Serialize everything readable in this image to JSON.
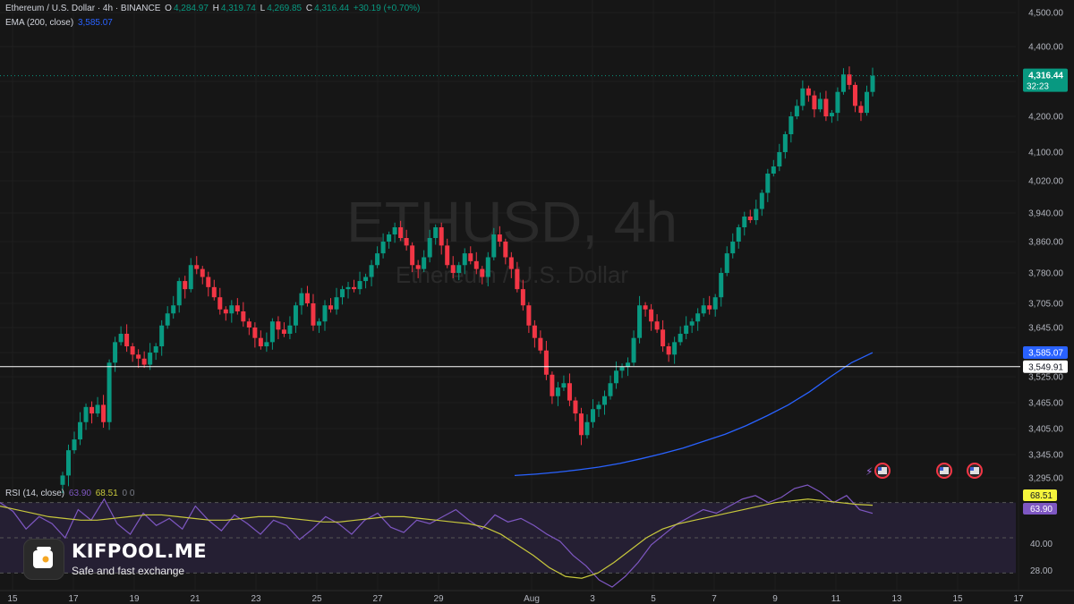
{
  "header": {
    "symbol_title": "Ethereum / U.S. Dollar · 4h · BINANCE",
    "open_label": "O",
    "open": "4,284.97",
    "high_label": "H",
    "high": "4,319.74",
    "low_label": "L",
    "low": "4,269.85",
    "close_label": "C",
    "close": "4,316.44",
    "change": "+30.19 (+0.70%)",
    "ema_label": "EMA (200, close)",
    "ema_value": "3,585.07",
    "rsi_label": "RSI (14, close)",
    "rsi_value": "63.90",
    "rsi_ma_value": "68.51",
    "rsi_extra": "0  0"
  },
  "watermark": {
    "symbol": "ETHUSD, 4h",
    "name": "Ethereum / U.S. Dollar"
  },
  "price_axis": {
    "ticks": [
      "4,500.00",
      "4,400.00",
      "4,300.00",
      "4,200.00",
      "4,100.00",
      "4,020.00",
      "3,940.00",
      "3,860.00",
      "3,780.00",
      "3,705.00",
      "3,645.00",
      "3,585.07",
      "3,549.91",
      "3,525.00",
      "3,465.00",
      "3,405.00",
      "3,345.00",
      "3,295.00"
    ],
    "last_price": "4,316.44",
    "countdown": "32:23",
    "ema_tag": "3,585.07",
    "crosshair_tag": "3,549.91"
  },
  "rsi_axis": {
    "ma_tag": "68.51",
    "rsi_tag": "63.90",
    "ticks": [
      "40.00",
      "28.00"
    ]
  },
  "time_axis": [
    "15",
    "17",
    "19",
    "21",
    "23",
    "25",
    "27",
    "29",
    "Aug",
    "3",
    "5",
    "7",
    "9",
    "11",
    "13",
    "15",
    "17"
  ],
  "logo": {
    "title": "KIFPOOL.ME",
    "subtitle": "Safe and fast exchange"
  },
  "colors": {
    "up": "#089981",
    "down": "#f23645",
    "ema": "#2962ff",
    "rsi": "#7e57c2",
    "rsi_ma": "#c8c83c",
    "bg": "#161616"
  },
  "chart_data": {
    "type": "candlestick",
    "interval": "4h",
    "price_range": [
      3265,
      4530
    ],
    "series": [
      {
        "name": "Ethereum / U.S. Dollar",
        "closes": [
          3300,
          3355,
          3380,
          3420,
          3455,
          3440,
          3460,
          3420,
          3560,
          3610,
          3630,
          3600,
          3580,
          3570,
          3555,
          3585,
          3600,
          3650,
          3680,
          3700,
          3760,
          3740,
          3800,
          3790,
          3770,
          3745,
          3720,
          3690,
          3680,
          3700,
          3685,
          3660,
          3645,
          3620,
          3600,
          3610,
          3660,
          3640,
          3630,
          3650,
          3700,
          3730,
          3705,
          3650,
          3660,
          3700,
          3690,
          3720,
          3740,
          3745,
          3740,
          3760,
          3770,
          3800,
          3830,
          3860,
          3880,
          3900,
          3870,
          3850,
          3800,
          3790,
          3820,
          3870,
          3900,
          3850,
          3800,
          3780,
          3800,
          3830,
          3810,
          3790,
          3770,
          3820,
          3880,
          3860,
          3820,
          3790,
          3740,
          3700,
          3650,
          3620,
          3590,
          3530,
          3480,
          3500,
          3510,
          3470,
          3440,
          3390,
          3420,
          3450,
          3460,
          3480,
          3510,
          3540,
          3550,
          3560,
          3620,
          3700,
          3690,
          3660,
          3640,
          3600,
          3580,
          3610,
          3630,
          3650,
          3660,
          3680,
          3700,
          3690,
          3720,
          3780,
          3830,
          3860,
          3900,
          3930,
          3920,
          3950,
          3990,
          4040,
          4060,
          4100,
          4150,
          4200,
          4230,
          4280,
          4260,
          4220,
          4250,
          4200,
          4210,
          4270,
          4320,
          4290,
          4230,
          4210,
          4270,
          4316.44
        ]
      },
      {
        "name": "EMA (200, close)",
        "values": [
          3300,
          3303,
          3307,
          3312,
          3318,
          3326,
          3336,
          3347,
          3360,
          3376,
          3392,
          3412,
          3435,
          3460,
          3490,
          3525,
          3560,
          3585
        ]
      },
      {
        "name": "RSI (14, close)",
        "range": [
          20,
          80
        ],
        "values": [
          70,
          65,
          55,
          62,
          58,
          50,
          66,
          60,
          72,
          58,
          52,
          64,
          57,
          61,
          55,
          68,
          60,
          54,
          63,
          58,
          52,
          60,
          57,
          49,
          55,
          62,
          58,
          52,
          60,
          64,
          56,
          53,
          60,
          58,
          62,
          66,
          60,
          55,
          63,
          59,
          61,
          57,
          52,
          48,
          40,
          34,
          26,
          22,
          28,
          36,
          46,
          52,
          58,
          62,
          66,
          64,
          68,
          72,
          74,
          70,
          73,
          78,
          80,
          76,
          70,
          74,
          66,
          63.9
        ]
      },
      {
        "name": "RSI-based MA",
        "values": [
          68,
          66,
          64,
          62,
          61,
          60,
          60,
          61,
          62,
          63,
          63,
          62,
          61,
          60,
          60,
          61,
          62,
          62,
          61,
          60,
          59,
          59,
          60,
          61,
          62,
          62,
          61,
          60,
          59,
          58,
          56,
          52,
          46,
          40,
          33,
          28,
          27,
          30,
          36,
          43,
          50,
          55,
          58,
          60,
          62,
          64,
          66,
          68,
          70,
          71,
          72,
          71,
          70,
          69,
          68.51
        ]
      }
    ],
    "levels": [
      {
        "name": "crosshair",
        "value": 3549.91
      },
      {
        "name": "last_price",
        "value": 4316.44
      }
    ],
    "rsi_levels": [
      70,
      50,
      30
    ]
  }
}
